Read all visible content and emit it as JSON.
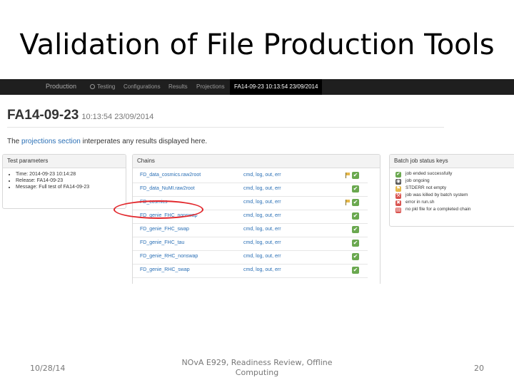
{
  "slide": {
    "title": "Validation of File Production Tools",
    "footer": {
      "date": "10/28/14",
      "center_line1": "NOvA E929, Readiness Review, Offline",
      "center_line2": "Computing",
      "page_number": "20"
    }
  },
  "navbar": {
    "brand": "Production",
    "items": [
      "Testing",
      "Configurations",
      "Results",
      "Projections"
    ],
    "active": "FA14-09-23 10:13:54 23/09/2014"
  },
  "page": {
    "title": "FA14-09-23",
    "subtitle": "10:13:54 23/09/2014",
    "intro_before": "The ",
    "intro_link": "projections section",
    "intro_after": " interperates any results displayed here."
  },
  "test_parameters": {
    "heading": "Test parameters",
    "items": [
      "Time: 2014-09-23 10:14:28",
      "Release: FA14-09-23",
      "Message: Full test of FA14-09-23"
    ]
  },
  "chains": {
    "heading": "Chains",
    "links": "cmd, log, out, err",
    "rows": [
      {
        "name": "FD_data_cosmics.raw2root",
        "flag": true
      },
      {
        "name": "FD_data_NuMI.raw2root",
        "flag": false
      },
      {
        "name": "FD_cosmics",
        "flag": true
      },
      {
        "name": "FD_genie_FHC_nonswap",
        "flag": false
      },
      {
        "name": "FD_genie_FHC_swap",
        "flag": false
      },
      {
        "name": "FD_genie_FHC_tau",
        "flag": false
      },
      {
        "name": "FD_genie_RHC_nonswap",
        "flag": false
      },
      {
        "name": "FD_genie_RHC_swap",
        "flag": false
      }
    ]
  },
  "batch_keys": {
    "heading": "Batch job status keys",
    "items": [
      {
        "label": "job ended successfully",
        "icon": "check-icon",
        "color": "#6aa84f"
      },
      {
        "label": "job ongoing",
        "icon": "eye-icon",
        "color": "#555555"
      },
      {
        "label": "STDERR not empty",
        "icon": "flag-icon",
        "color": "#e7b84a"
      },
      {
        "label": "job was killed by batch system",
        "icon": "wrench-icon",
        "color": "#d9534f"
      },
      {
        "label": "error in run.sh",
        "icon": "cross-icon",
        "color": "#d9534f"
      },
      {
        "label": "no pkl file for a completed chain",
        "icon": "file-icon",
        "color": "#d9534f"
      }
    ]
  }
}
